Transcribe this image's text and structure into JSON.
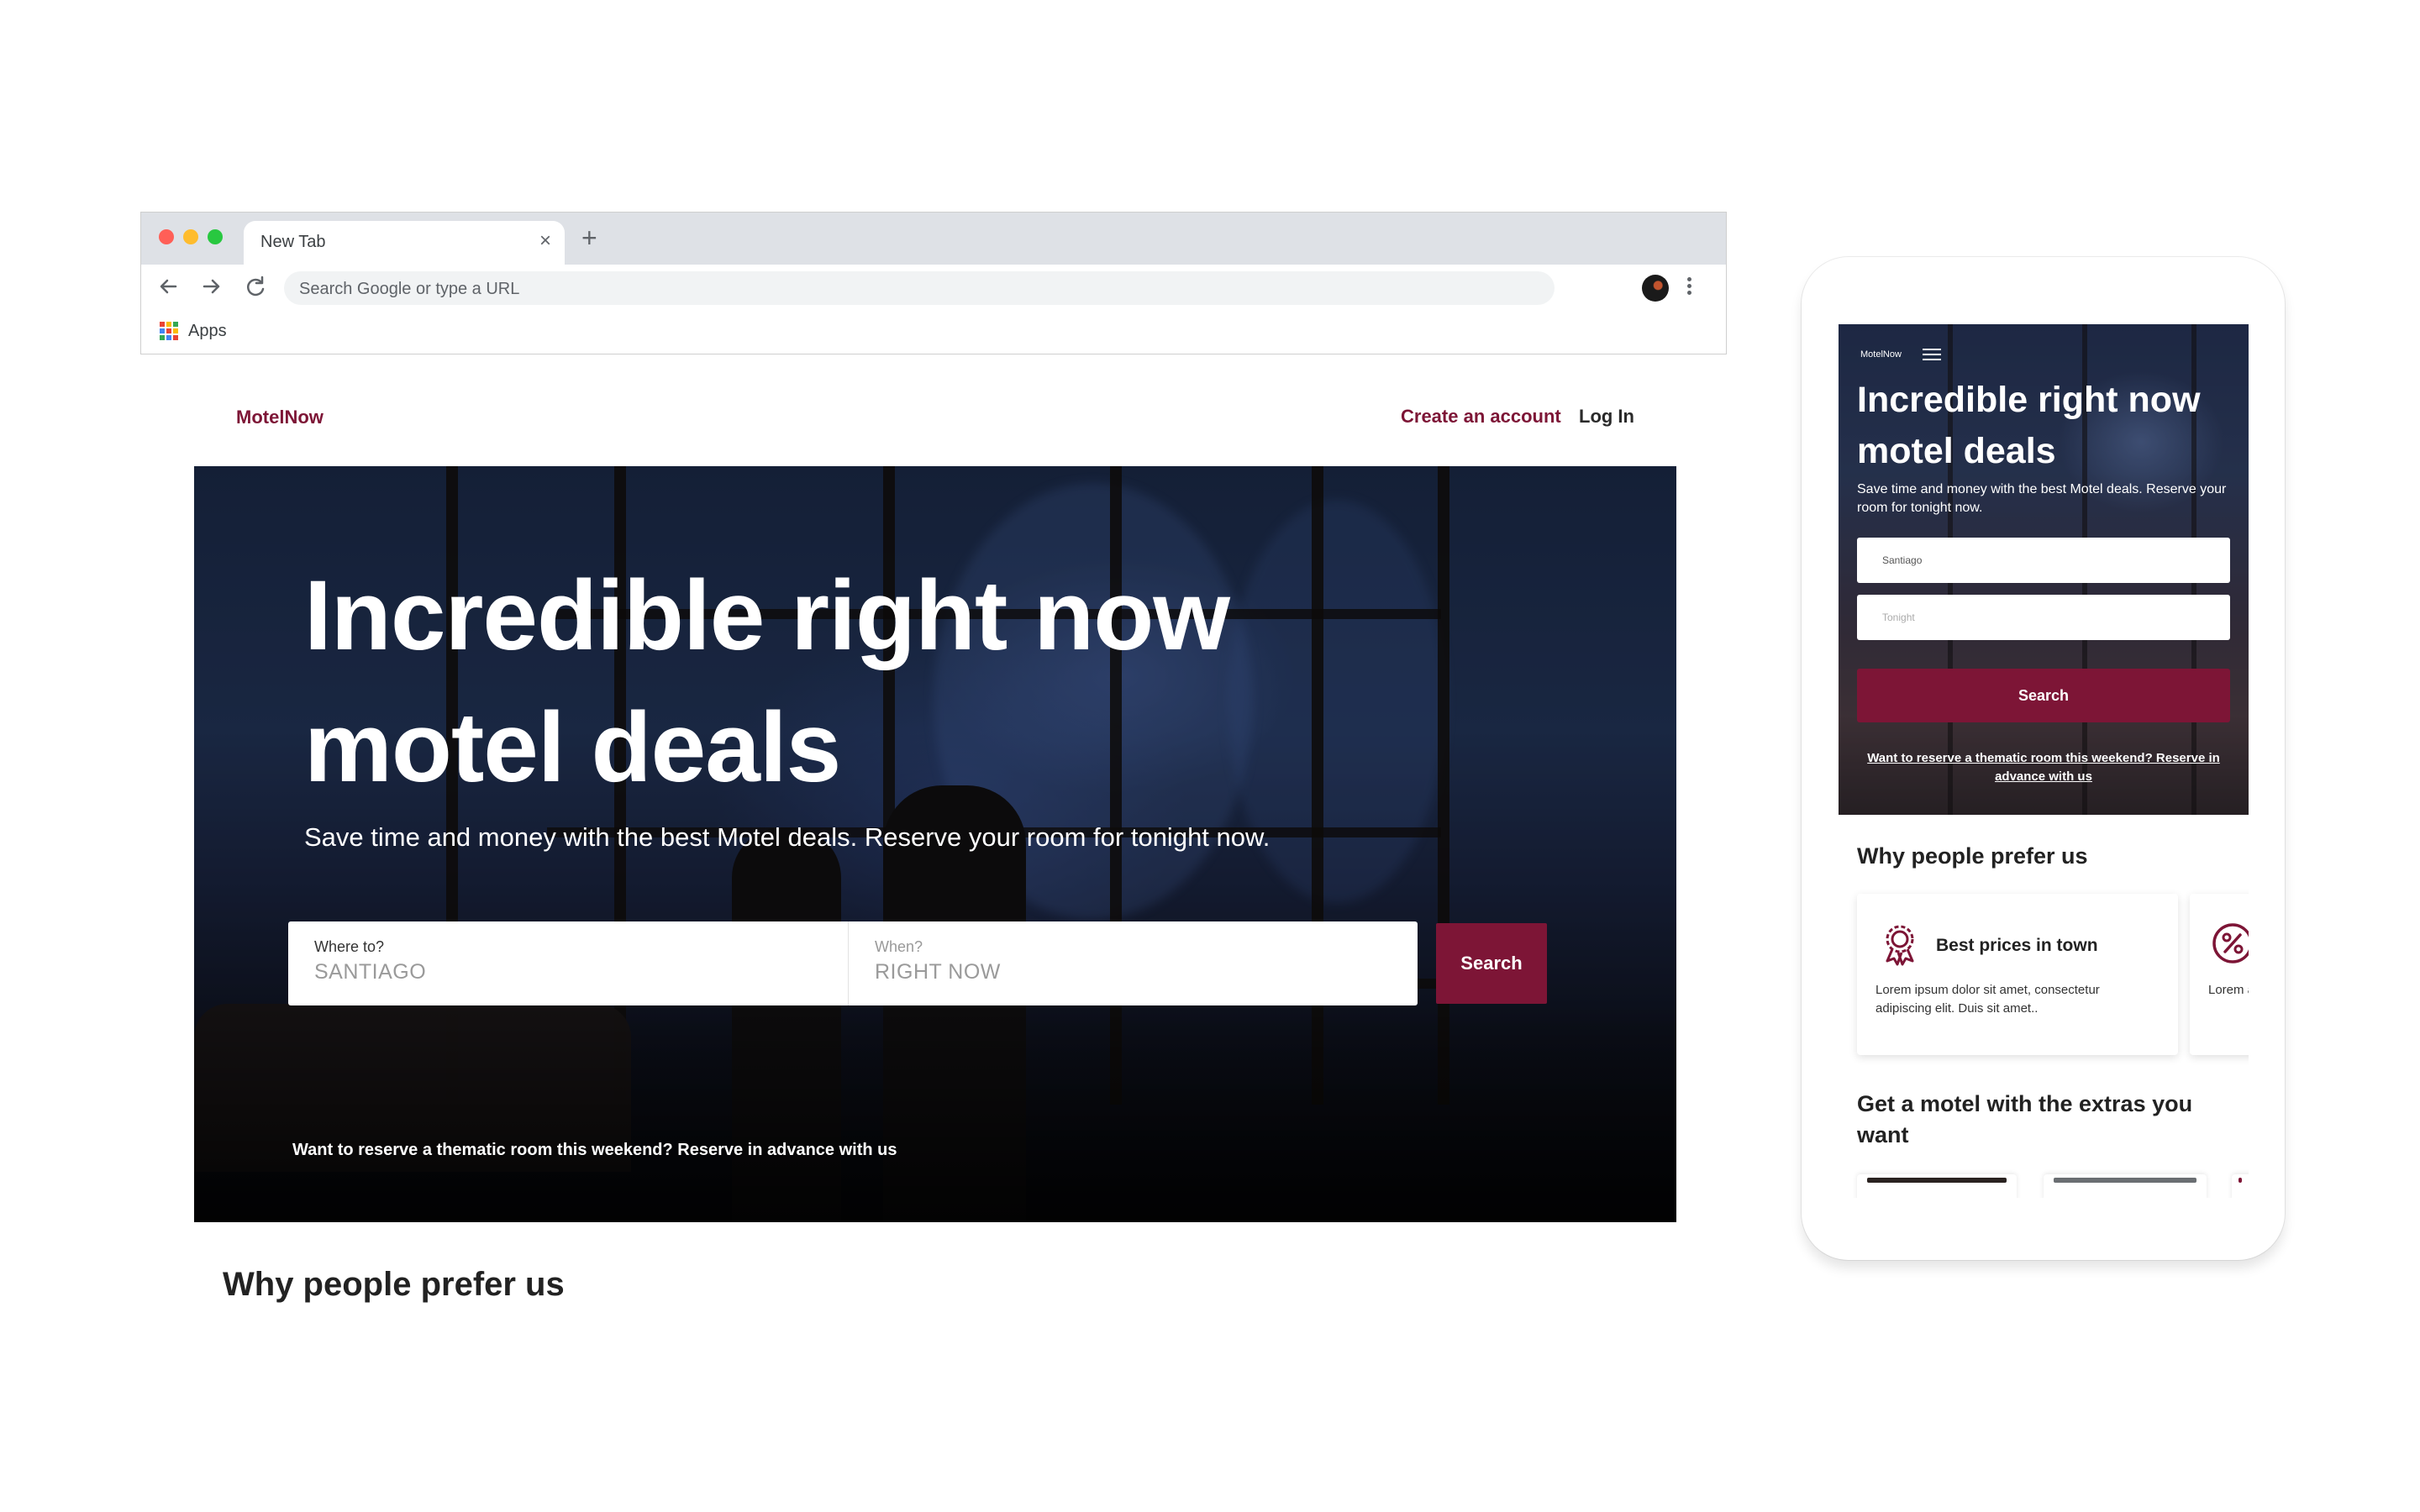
{
  "browser": {
    "tab_title": "New Tab",
    "tab_close": "×",
    "new_tab": "+",
    "omnibox_placeholder": "Search Google or type a URL",
    "bookmark_apps": "Apps"
  },
  "desktop": {
    "logo": "MotelNow",
    "nav": {
      "create_account": "Create an account",
      "login": "Log In"
    },
    "hero": {
      "title": "Incredible right now motel deals",
      "subtitle": "Save time and money with the best Motel deals. Reserve your room for tonight now.",
      "where_label": "Where to?",
      "where_value": "SANTIAGO",
      "when_label": "When?",
      "when_value": "RIGHT NOW",
      "search_button": "Search",
      "note": "Want to reserve a thematic room this weekend? Reserve in advance with us"
    },
    "why_heading": "Why people prefer us"
  },
  "mobile": {
    "logo": "MotelNow",
    "hero": {
      "title": "Incredible right now motel deals",
      "subtitle": "Save time and money with the best Motel deals. Reserve your room for tonight now.",
      "input_where": "Santiago",
      "input_when": "Tonight",
      "search_button": "Search",
      "note": "Want to reserve a thematic room this weekend? Reserve in advance with us"
    },
    "why_heading": "Why people prefer us",
    "cards": [
      {
        "title": "Best prices in town",
        "text": "Lorem ipsum dolor sit amet, consectetur adipiscing elit. Duis sit amet.."
      },
      {
        "title": "",
        "text": "Lorem adipisc"
      }
    ],
    "extras_heading": "Get a motel with the extras you want"
  },
  "colors": {
    "brand": "#7d1536",
    "text_dark": "#222222",
    "mac_red": "#ff5f57",
    "mac_yellow": "#febc2e",
    "mac_green": "#28c840"
  },
  "icons": [
    "back-arrow-icon",
    "forward-arrow-icon",
    "reload-icon",
    "apps-grid-icon",
    "kebab-menu-icon",
    "hamburger-menu-icon",
    "award-badge-icon",
    "percent-icon"
  ]
}
